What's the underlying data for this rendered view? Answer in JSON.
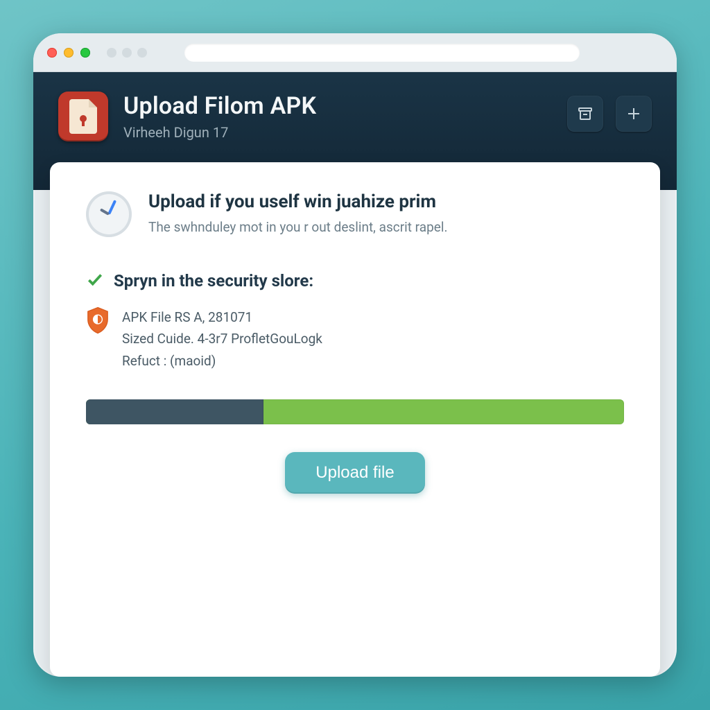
{
  "header": {
    "title": "Upload Filom APK",
    "subtitle": "Virheeh Digun 17"
  },
  "header_actions": {
    "archive_icon": "archive-icon",
    "add_icon": "plus-icon"
  },
  "intro": {
    "icon": "clock-icon",
    "heading": "Upload if you uself win juahize prim",
    "body": "The swhnduley mot in you r out deslint, ascrit rapel."
  },
  "security": {
    "check_icon": "check-icon",
    "heading": "Spryn in the security slore:",
    "shield_icon": "shield-icon",
    "lines": [
      "APK File RS A, 281071",
      "Sized Cuide. 4-3r7 ProfletGouLogk",
      "Refuct : (maoid)"
    ]
  },
  "progress": {
    "percent": 33
  },
  "cta": {
    "label": "Upload file"
  }
}
